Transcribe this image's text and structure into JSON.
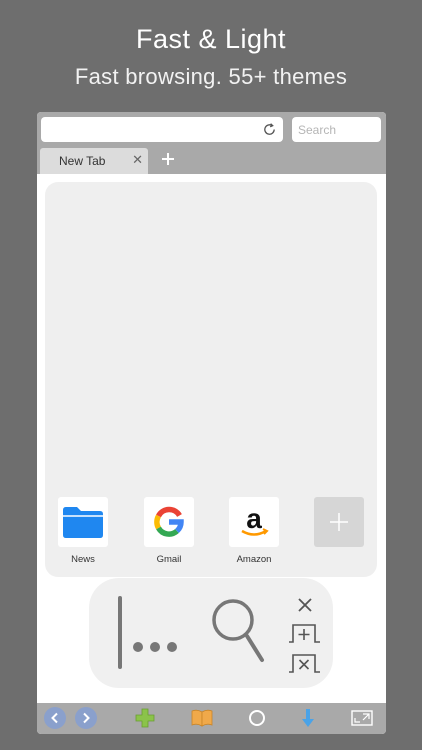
{
  "promo": {
    "headline": "Fast & Light",
    "subline": "Fast browsing. 55+ themes"
  },
  "toolbar": {
    "search_placeholder": "Search",
    "url_value": ""
  },
  "tabs": [
    {
      "label": "New Tab",
      "close_glyph": "✕"
    }
  ],
  "speed_dial": {
    "items": [
      {
        "label": "News",
        "icon": "folder-icon"
      },
      {
        "label": "Gmail",
        "icon": "google-g-icon"
      },
      {
        "label": "Amazon",
        "icon": "amazon-a-icon"
      }
    ],
    "add_icon": "plus-icon"
  },
  "gesture_panel": {
    "icons": [
      "cursor-more-icon",
      "magnifier-icon",
      "close-icon",
      "new-tab-icon",
      "close-tab-icon"
    ]
  },
  "bottom_bar": {
    "icons": [
      "back-icon",
      "forward-icon",
      "add-icon",
      "bookmarks-icon",
      "home-circle-icon",
      "download-icon",
      "fullscreen-icon"
    ]
  },
  "colors": {
    "page_background": "#6e6e6e",
    "toolbar": "#a9a9a9",
    "nav_button": "#8aa0cc",
    "add_green": "#8bc34a",
    "bookmark_orange": "#f0a94a",
    "download_blue": "#4aa3e8",
    "folder_blue": "#1f87f0"
  }
}
